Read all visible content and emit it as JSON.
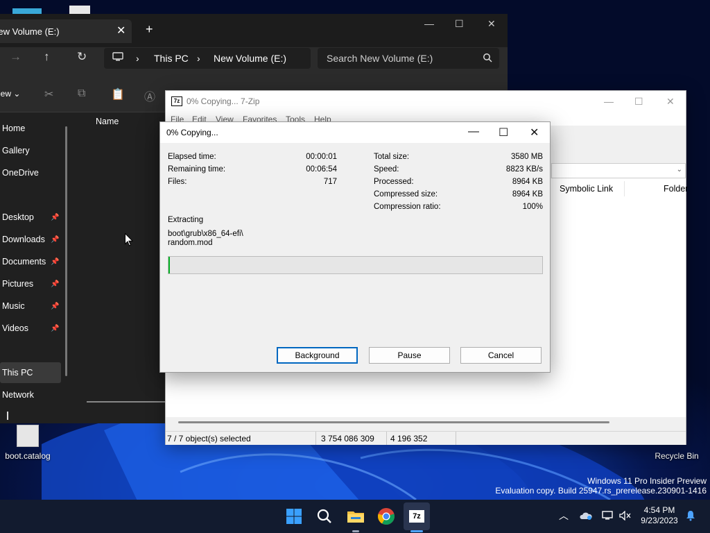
{
  "explorer": {
    "tab_title": "New Volume (E:)",
    "breadcrumb": [
      "This PC",
      "New Volume (E:)"
    ],
    "search_placeholder": "Search New Volume (E:)",
    "new_label": "New",
    "column_name": "Name",
    "sidebar": [
      {
        "label": "Home",
        "pinned": false
      },
      {
        "label": "Gallery",
        "pinned": false
      },
      {
        "label": "OneDrive",
        "pinned": false
      },
      {
        "label": "Desktop",
        "pinned": true
      },
      {
        "label": "Downloads",
        "pinned": true
      },
      {
        "label": "Documents",
        "pinned": true
      },
      {
        "label": "Pictures",
        "pinned": true
      },
      {
        "label": "Music",
        "pinned": true
      },
      {
        "label": "Videos",
        "pinned": true
      },
      {
        "label": "This PC",
        "pinned": false
      },
      {
        "label": "Network",
        "pinned": false
      }
    ]
  },
  "zip_window": {
    "title": "0% Copying... 7-Zip",
    "menu": [
      "File",
      "Edit",
      "View",
      "Favorites",
      "Tools",
      "Help"
    ],
    "columns": [
      "Symbolic Link",
      "Folder"
    ],
    "status": [
      "7 / 7 object(s) selected",
      "3 754 086 309",
      "4 196 352"
    ]
  },
  "dialog": {
    "title": "0% Copying...",
    "left_stats": [
      {
        "label": "Elapsed time:",
        "value": "00:00:01"
      },
      {
        "label": "Remaining time:",
        "value": "00:06:54"
      },
      {
        "label": "Files:",
        "value": "717"
      }
    ],
    "right_stats": [
      {
        "label": "Total size:",
        "value": "3580 MB"
      },
      {
        "label": "Speed:",
        "value": "8823 KB/s"
      },
      {
        "label": "Processed:",
        "value": "8964 KB"
      },
      {
        "label": "Compressed size:",
        "value": "8964 KB"
      },
      {
        "label": "Compression ratio:",
        "value": "100%"
      }
    ],
    "operation": "Extracting",
    "current_path": "boot\\grub\\x86_64-efi\\",
    "current_file": "random.mod",
    "progress_percent": 0.3,
    "buttons": {
      "background": "Background",
      "pause": "Pause",
      "cancel": "Cancel"
    }
  },
  "desktop": {
    "icons": [
      "boot.catalog",
      "Recycle Bin"
    ],
    "watermark": [
      "Windows 11 Pro Insider Preview",
      "Evaluation copy. Build 25947.rs_prerelease.230901-1416"
    ]
  },
  "taskbar": {
    "apps": [
      "start",
      "search",
      "file-explorer",
      "chrome",
      "7-zip"
    ],
    "time": "4:54 PM",
    "date": "9/23/2023"
  },
  "colors": {
    "accent": "#0067c0",
    "progress": "#06b025",
    "taskbar": "#121b2f",
    "explorer_bg": "#202020"
  }
}
